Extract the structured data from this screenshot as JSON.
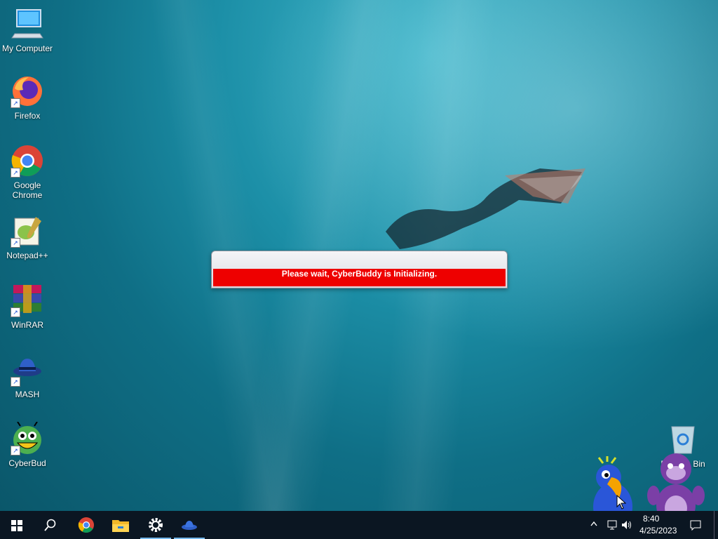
{
  "desktop": {
    "icons": [
      {
        "label": "My Computer"
      },
      {
        "label": "Firefox"
      },
      {
        "label": "Google Chrome"
      },
      {
        "label": "Notepad++"
      },
      {
        "label": "WinRAR"
      },
      {
        "label": "MASH"
      },
      {
        "label": "CyberBud"
      },
      {
        "label": "Recycle Bin"
      }
    ]
  },
  "dialog": {
    "message": "Please wait, CyberBuddy is Initializing."
  },
  "taskbar": {
    "items": [
      "start-icon",
      "search-icon",
      "chrome-icon",
      "file-explorer-icon",
      "settings-icon",
      "mash-icon"
    ],
    "clock": {
      "time": "8:40",
      "date": "4/25/2023"
    }
  },
  "colors": {
    "dialog_bar": "#ee0000",
    "taskbar": "#0b1622"
  }
}
